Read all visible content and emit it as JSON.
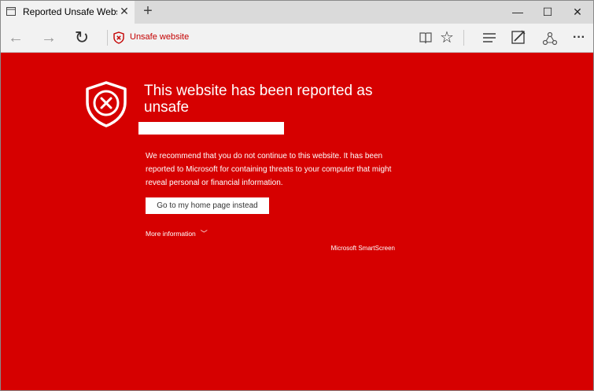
{
  "window": {
    "tab_title": "Reported Unsafe Websit",
    "tab_close": "✕",
    "new_tab": "+",
    "minimize": "—",
    "maximize": "☐",
    "close": "✕"
  },
  "toolbar": {
    "back": "←",
    "forward": "→",
    "refresh": "↻",
    "address_text": "Unsafe website",
    "reading_view_icon": "book-icon",
    "favorite": "☆",
    "hub_icon": "hub-icon",
    "web_note_icon": "web-note-icon",
    "share_icon": "share-icon",
    "more": "···"
  },
  "warning": {
    "heading": "This website has been reported as unsafe",
    "body": "We recommend that you do not continue to this website. It has been reported to Microsoft for containing threats to your computer that might reveal personal or financial information.",
    "home_button": "Go to my home page instead",
    "more_info": "More information",
    "brand": "Microsoft SmartScreen"
  },
  "colors": {
    "background": "#d60000",
    "accent": "#c40000"
  }
}
